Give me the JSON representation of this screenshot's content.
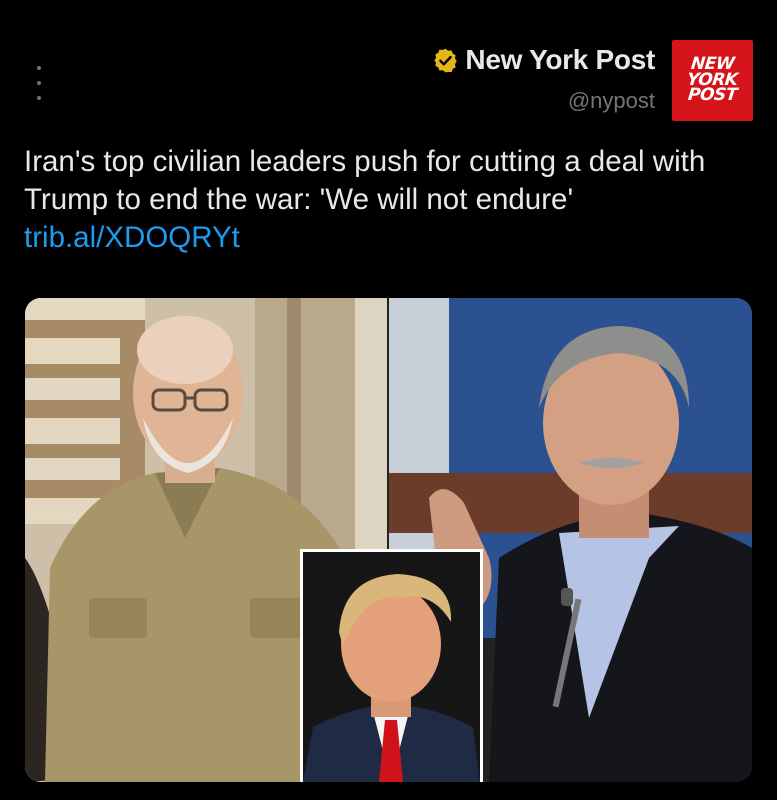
{
  "post": {
    "author": {
      "display_name": "New York Post",
      "handle": "@nypost",
      "verified": true,
      "verified_badge_color": "#e2b719"
    },
    "logo_lines": [
      "NEW",
      "YORK",
      "POST"
    ],
    "logo_color": "#d4131b",
    "text": "Iran's top civilian leaders push for cutting a deal with Trump to end the war: 'We will not endure'",
    "link": "trib.al/XDOQRYt",
    "link_color": "#1d9bf0"
  },
  "icons": {
    "more": "more-vertical-icon",
    "verified": "verified-badge-icon"
  },
  "media": {
    "type": "photo-collage",
    "panels": [
      "left-portrait",
      "right-portrait",
      "inset-portrait"
    ]
  }
}
